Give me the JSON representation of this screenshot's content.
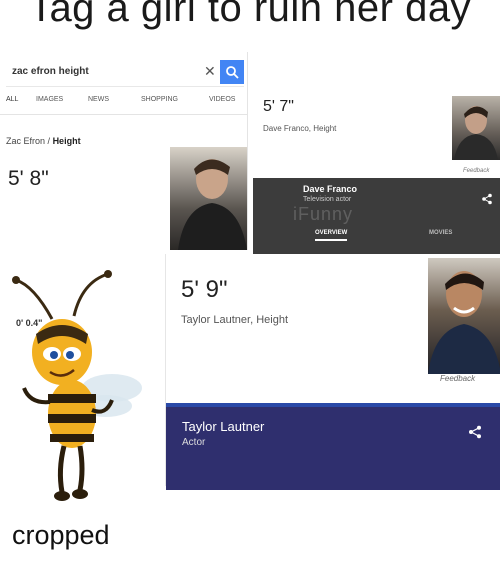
{
  "meme": {
    "title": "Tag a girl to ruin her day",
    "caption": "cropped"
  },
  "zac_panel": {
    "search_query": "zac efron height",
    "tabs": [
      "ALL",
      "IMAGES",
      "NEWS",
      "SHOPPING",
      "VIDEOS"
    ],
    "breadcrumb_name": "Zac Efron",
    "breadcrumb_sep": "/",
    "breadcrumb_attr": "Height",
    "height": "5' 8\""
  },
  "dave_panel": {
    "height": "5' 7\"",
    "subtitle": "Dave Franco, Height",
    "feedback": "Feedback",
    "name": "Dave Franco",
    "role": "Television actor",
    "watermark": "iFunny",
    "tab_overview": "OVERVIEW",
    "tab_movies": "MOVIES"
  },
  "bee_panel": {
    "height": "0' 0.4\""
  },
  "taylor_panel": {
    "height": "5' 9\"",
    "subtitle": "Taylor Lautner, Height",
    "feedback": "Feedback",
    "name": "Taylor Lautner",
    "role": "Actor"
  },
  "colors": {
    "search_button": "#4285f4",
    "dark_card": "#3c3c3c",
    "navy_card": "#2f2f6e"
  }
}
